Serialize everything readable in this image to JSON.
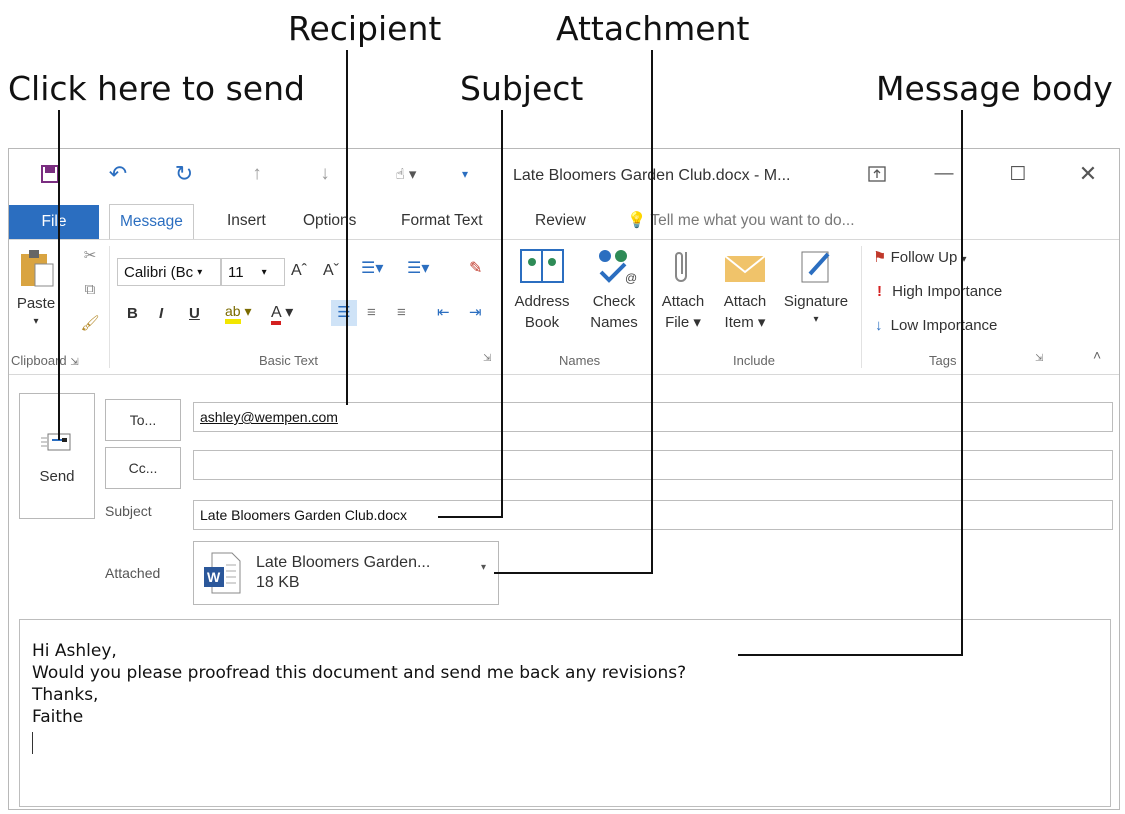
{
  "callouts": {
    "recipient": "Recipient",
    "attachment": "Attachment",
    "click_send": "Click here to send",
    "subject": "Subject",
    "message_body": "Message body"
  },
  "titlebar": {
    "title": "Late Bloomers Garden Club.docx - M...",
    "icons": [
      "save-icon",
      "undo-icon",
      "redo-icon",
      "up-arrow-icon",
      "down-arrow-icon",
      "touch-mode-icon",
      "customize-icon",
      "ribbon-display-icon",
      "minimize-icon",
      "maximize-icon",
      "close-icon"
    ]
  },
  "tabs": {
    "file": "File",
    "message": "Message",
    "insert": "Insert",
    "options": "Options",
    "format_text": "Format Text",
    "review": "Review",
    "tell_me": "Tell me what you want to do..."
  },
  "ribbon": {
    "clipboard": {
      "paste": "Paste",
      "label": "Clipboard"
    },
    "basic_text": {
      "font": "Calibri (Bc",
      "size": "11",
      "bold": "B",
      "italic": "I",
      "underline": "U",
      "label": "Basic Text"
    },
    "names": {
      "address": "Address",
      "book": "Book",
      "check": "Check",
      "names_btn": "Names",
      "label": "Names"
    },
    "include": {
      "attach": "Attach",
      "file": "File",
      "item": "Item",
      "signature": "Signature",
      "label": "Include"
    },
    "tags": {
      "follow_up": "Follow Up",
      "high": "High Importance",
      "low": "Low Importance",
      "label": "Tags"
    },
    "accent": "#2b6ec0"
  },
  "compose": {
    "send": "Send",
    "to": "To...",
    "cc": "Cc...",
    "to_value": "ashley@wempen.com",
    "cc_value": "",
    "subject_label": "Subject",
    "subject_value": "Late Bloomers Garden Club.docx",
    "attached_label": "Attached",
    "attachment_name": "Late Bloomers Garden...",
    "attachment_size": "18 KB"
  },
  "message": {
    "lines": [
      "Hi Ashley,",
      "Would you please proofread this document and send me back any revisions?",
      "Thanks,",
      "Faithe"
    ]
  }
}
